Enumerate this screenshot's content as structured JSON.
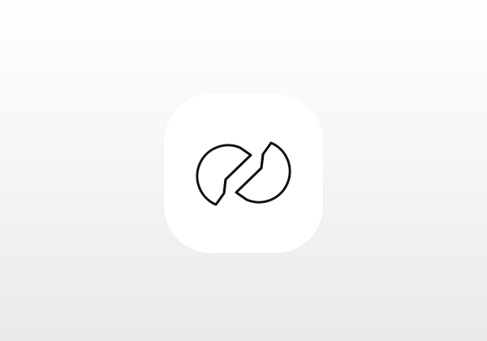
{
  "app_icon": {
    "icon": "unfold-logo-icon",
    "background_color": "#ffffff",
    "glyph_color": "#111111"
  },
  "page": {
    "background_top": "#ffffff",
    "background_bottom": "#eaeaea"
  }
}
